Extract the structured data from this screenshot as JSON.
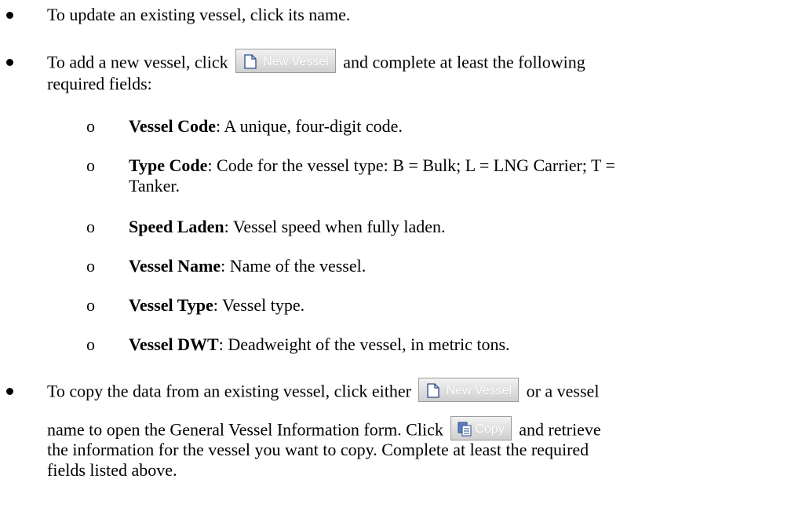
{
  "bullets": [
    {
      "text": "To update an existing vessel, click its name."
    },
    {
      "before": "To add a new vessel, click",
      "button": "New Vessel",
      "after": "and complete at least the following",
      "line2": "required fields:"
    },
    {
      "before": "To copy the data from an existing vessel, click either",
      "button": "New Vessel",
      "after": "or a vessel",
      "line2_before": "name to open the General Vessel Information form. Click",
      "button2": "Copy",
      "line2_after": "and retrieve",
      "line3": "the information for the vessel you want to copy. Complete at least the required",
      "line4": "fields listed above."
    }
  ],
  "sub_marker": "o",
  "fields": [
    {
      "name": "Vessel Code",
      "desc": ": A unique, four-digit code."
    },
    {
      "name": "Type Code",
      "desc": ": Code for the vessel type: B = Bulk; L = LNG Carrier; T =",
      "desc2": "Tanker."
    },
    {
      "name": "Speed Laden",
      "desc": ": Vessel speed when fully laden."
    },
    {
      "name": "Vessel Name",
      "desc": ": Name of the vessel."
    },
    {
      "name": "Vessel Type",
      "desc": ": Vessel type."
    },
    {
      "name": "Vessel DWT",
      "desc": ": Deadweight of the vessel, in metric tons."
    }
  ],
  "icons": {
    "new_vessel": "document-icon",
    "copy": "copy-icon"
  }
}
